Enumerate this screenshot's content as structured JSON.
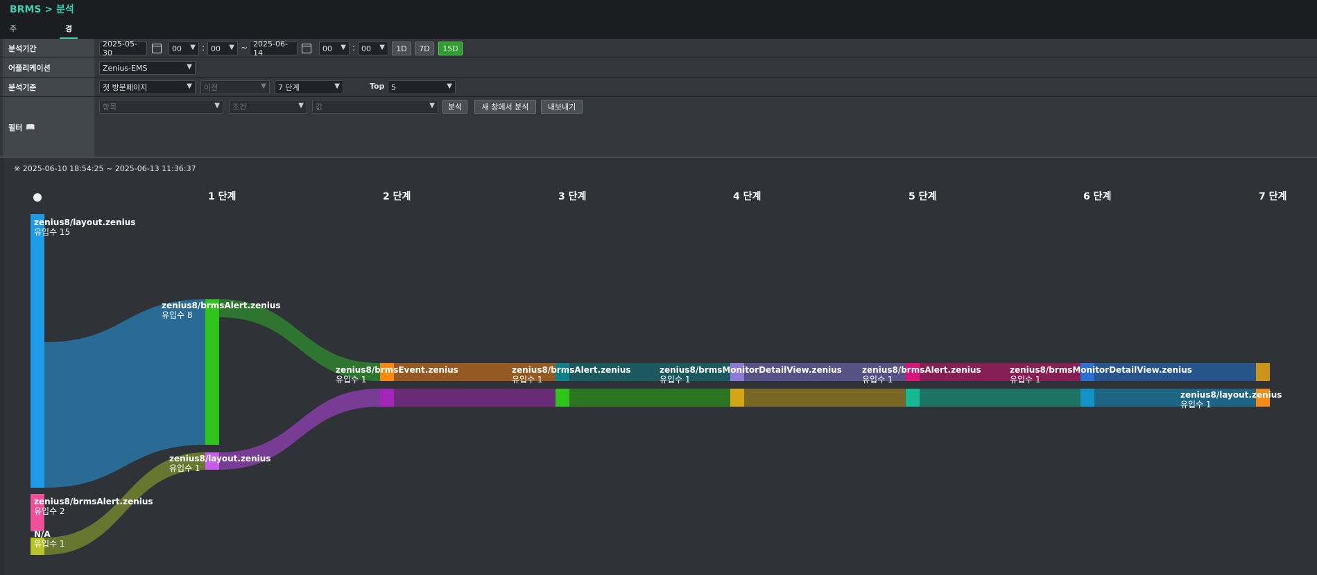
{
  "breadcrumb": {
    "app": "BRMS",
    "sep": ">",
    "page": "분석"
  },
  "tabs": [
    {
      "label": "주제별 분석"
    },
    {
      "label": "경로 탐색"
    }
  ],
  "form": {
    "period": {
      "label": "분석기간",
      "start_date": "2025-05-30",
      "start_hour": "00",
      "start_min": "00",
      "tilde": "~",
      "end_date": "2025-06-14",
      "end_hour": "00",
      "end_min": "00",
      "colon": ":",
      "quick": [
        "1D",
        "7D",
        "15D"
      ],
      "quick_active": "15D"
    },
    "application": {
      "label": "어플리케이션",
      "value": "Zenius-EMS"
    },
    "criteria": {
      "label": "분석기준",
      "basis": "첫 방문페이지",
      "direction": "이전",
      "steps": "7 단계",
      "top_label": "Top",
      "top_value": "5"
    },
    "filter": {
      "label": "필터",
      "icon": "book-icon",
      "item_placeholder": "항목",
      "cond_placeholder": "조건",
      "value_placeholder": "값",
      "analyze_button": "분석",
      "new_window_button": "새 창에서 분석",
      "export_button": "내보내기"
    }
  },
  "result": {
    "range_text": "※ 2025-06-10 18:54:25 ~ 2025-06-13 11:36:37",
    "stages": [
      "1 단계",
      "2 단계",
      "3 단계",
      "4 단계",
      "5 단계",
      "6 단계",
      "7 단계"
    ]
  },
  "sankey_nodes": [
    {
      "name": "zenius8/layout.zenius",
      "count": "유입수 15",
      "color": "#1e9be8"
    },
    {
      "name": "zenius8/brmsAlert.zenius",
      "count": "유입수 2",
      "color": "#f0509a"
    },
    {
      "name": "N/A",
      "count": "유입수 1",
      "color": "#b8c526"
    },
    {
      "name": "zenius8/brmsAlert.zenius",
      "count": "유입수 8",
      "color": "#2ec41a"
    },
    {
      "name": "zenius8/layout.zenius",
      "count": "유입수 1",
      "color": "#c55ee8"
    },
    {
      "name": "zenius8/brmsEvent.zenius",
      "count": "유입수 1",
      "color": "#f58a14"
    },
    {
      "name": "",
      "count": "",
      "color": "#a326b8"
    },
    {
      "name": "zenius8/brmsAlert.zenius",
      "count": "유입수 1",
      "color": "#0f7f88"
    },
    {
      "name": "",
      "count": "",
      "color": "#2ec41a"
    },
    {
      "name": "zenius8/brmsMonitorDetailView.zenius",
      "count": "유입수 1",
      "color": "#8a7ad6"
    },
    {
      "name": "",
      "count": "",
      "color": "#d4a514"
    },
    {
      "name": "zenius8/brmsAlert.zenius",
      "count": "유입수 1",
      "color": "#d6167a"
    },
    {
      "name": "",
      "count": "",
      "color": "#14b893"
    },
    {
      "name": "zenius8/brmsMonitorDetailView.zenius",
      "count": "유입수 1",
      "color": "#2d6fd1"
    },
    {
      "name": "",
      "count": "",
      "color": "#1394c8"
    },
    {
      "name": "",
      "count": "",
      "color": "#c9961a"
    },
    {
      "name": "zenius8/layout.zenius",
      "count": "유입수 1",
      "color": "#f58a14"
    }
  ]
}
